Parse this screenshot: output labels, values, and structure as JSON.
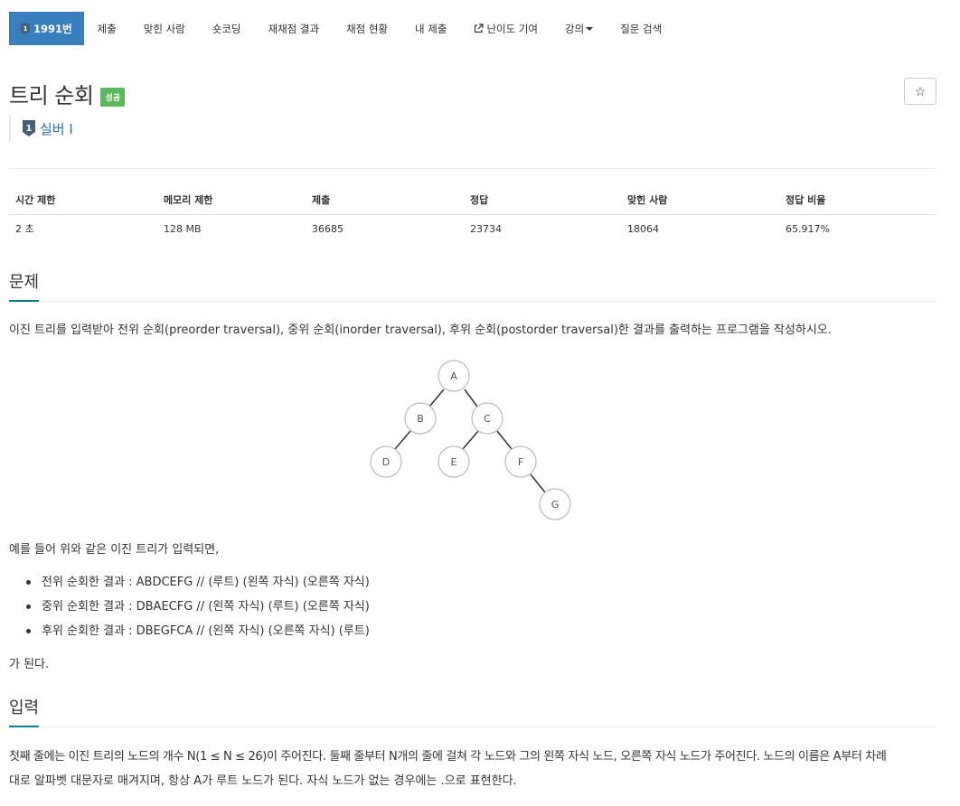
{
  "nav": {
    "items": [
      {
        "label": "1991번",
        "active": true
      },
      {
        "label": "제출"
      },
      {
        "label": "맞힌 사람"
      },
      {
        "label": "숏코딩"
      },
      {
        "label": "재채점 결과"
      },
      {
        "label": "채점 현황"
      },
      {
        "label": "내 제출"
      },
      {
        "label": "난이도 기여",
        "icon": "external-link-icon"
      },
      {
        "label": "강의",
        "icon": "caret-down-icon"
      },
      {
        "label": "질문 검색"
      }
    ]
  },
  "problem": {
    "title": "트리 순회",
    "status": "성공",
    "star": "☆",
    "tier": "실버 I",
    "tier_badge_number": "1"
  },
  "info": {
    "headers": [
      "시간 제한",
      "메모리 제한",
      "제출",
      "정답",
      "맞힌 사람",
      "정답 비율"
    ],
    "values": [
      "2 초",
      "128 MB",
      "36685",
      "23734",
      "18064",
      "65.917%"
    ]
  },
  "sections": {
    "problem_heading": "문제",
    "description": "이진 트리를 입력받아 전위 순회(preorder traversal), 중위 순회(inorder traversal), 후위 순회(postorder traversal)한 결과를 출력하는 프로그램을 작성하시오.",
    "example_intro": "예를 들어 위와 같은 이진 트리가 입력되면,",
    "bullets": [
      "전위 순회한 결과 : ABDCEFG // (루트) (왼쪽 자식) (오른쪽 자식)",
      "중위 순회한 결과 : DBAECFG // (왼쪽 자식) (루트) (오른쪽 자식)",
      "후위 순회한 결과 : DBEGFCA // (왼쪽 자식) (오른쪽 자식) (루트)"
    ],
    "conclusion": "가 된다.",
    "input_heading": "입력",
    "input_line1": "첫째 줄에는 이진 트리의 노드의 개수 N(1 ≤ N ≤ 26)이 주어진다. 둘째 줄부터 N개의 줄에 걸쳐 각 노드와 그의 왼쪽 자식 노드, 오른쪽 자식 노드가 주어진다. 노드의 이름은 A부터 차례",
    "input_line2": "대로 알파벳 대문자로 매겨지며, 항상 A가 루트 노드가 된다. 자식 노드가 없는 경우에는 .으로 표현한다."
  },
  "tree_nodes": [
    "A",
    "B",
    "C",
    "D",
    "E",
    "F",
    "G"
  ]
}
